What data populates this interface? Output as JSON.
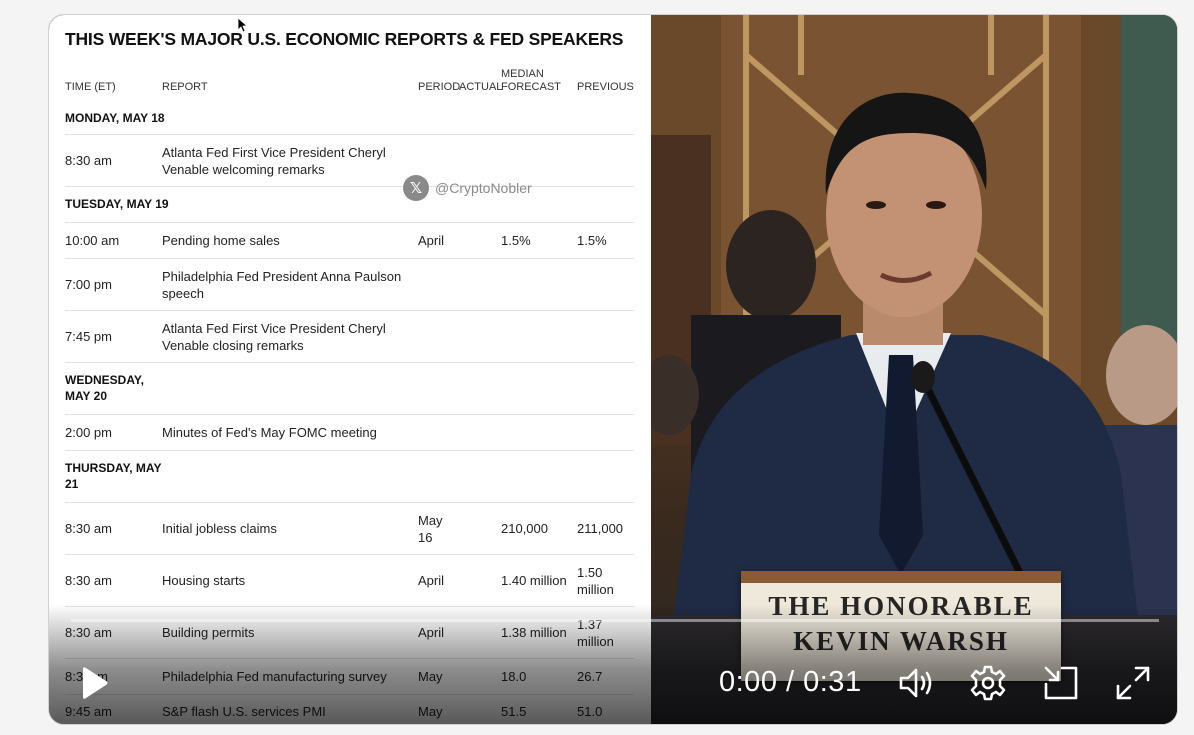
{
  "calendar": {
    "title": "THIS WEEK'S MAJOR U.S. ECONOMIC REPORTS & FED SPEAKERS",
    "headers": {
      "time": "TIME (ET)",
      "report": "REPORT",
      "period": "PERIOD",
      "actual": "ACTUAL",
      "median_line1": "MEDIAN",
      "median_line2": "FORECAST",
      "previous": "PREVIOUS"
    },
    "days": {
      "mon": "MONDAY, MAY 18",
      "tue": "TUESDAY, MAY 19",
      "wed_line1": "WEDNESDAY,",
      "wed_line2": "MAY 20",
      "thu_line1": "THURSDAY, MAY",
      "thu_line2": "21"
    },
    "rows": [
      {
        "time": "8:30 am",
        "report_line1": "Atlanta Fed First Vice President Cheryl",
        "report_line2": "Venable welcoming remarks",
        "period": "",
        "median": "",
        "previous": ""
      },
      {
        "time": "10:00 am",
        "report_line1": "Pending home sales",
        "report_line2": "",
        "period": "April",
        "median": "1.5%",
        "previous": "1.5%"
      },
      {
        "time": "7:00 pm",
        "report_line1": "Philadelphia Fed President Anna Paulson",
        "report_line2": "speech",
        "period": "",
        "median": "",
        "previous": ""
      },
      {
        "time": "7:45 pm",
        "report_line1": "Atlanta Fed First Vice President Cheryl",
        "report_line2": "Venable closing remarks",
        "period": "",
        "median": "",
        "previous": ""
      },
      {
        "time": "2:00 pm",
        "report_line1": "Minutes of Fed's May FOMC meeting",
        "report_line2": "",
        "period": "",
        "median": "",
        "previous": ""
      },
      {
        "time": "8:30 am",
        "report_line1": "Initial jobless claims",
        "report_line2": "",
        "period_line1": "May",
        "period_line2": "16",
        "median": "210,000",
        "previous": "211,000"
      },
      {
        "time": "8:30 am",
        "report_line1": "Housing starts",
        "report_line2": "",
        "period": "April",
        "median": "1.40 million",
        "previous_line1": "1.50",
        "previous_line2": "million"
      },
      {
        "time": "8:30 am",
        "report_line1": "Building permits",
        "report_line2": "",
        "period": "April",
        "median": "1.38 million",
        "previous_line1": "1.37",
        "previous_line2": "million"
      },
      {
        "time": "8:3",
        "time_tail": "m",
        "report_line1": "Philadelphia Fed manufacturing survey",
        "report_line2": "",
        "period": "May",
        "median": "18.0",
        "previous": "26.7"
      },
      {
        "time": "9:45 am",
        "report_line1": "S&P flash U.S. services PMI",
        "report_line2": "",
        "period": "May",
        "median": "51.5",
        "previous": "51.0"
      }
    ],
    "watermark": {
      "icon": "x-logo-icon",
      "handle": "@CryptoNobler"
    }
  },
  "video": {
    "nameplate_line1": "THE HONORABLE",
    "nameplate_line2": "KEVIN WARSH",
    "current_time": "0:00",
    "separator": " / ",
    "duration": "0:31",
    "progress": 0.0
  },
  "controls": {
    "play_icon": "play-icon",
    "volume_icon": "volume-icon",
    "settings_icon": "gear-icon",
    "pip_icon": "picture-in-picture-icon",
    "fullscreen_icon": "expand-icon"
  },
  "colors": {
    "accent": "#ffffff",
    "wood": "#6b4a2c",
    "suit": "#1f2a44"
  }
}
